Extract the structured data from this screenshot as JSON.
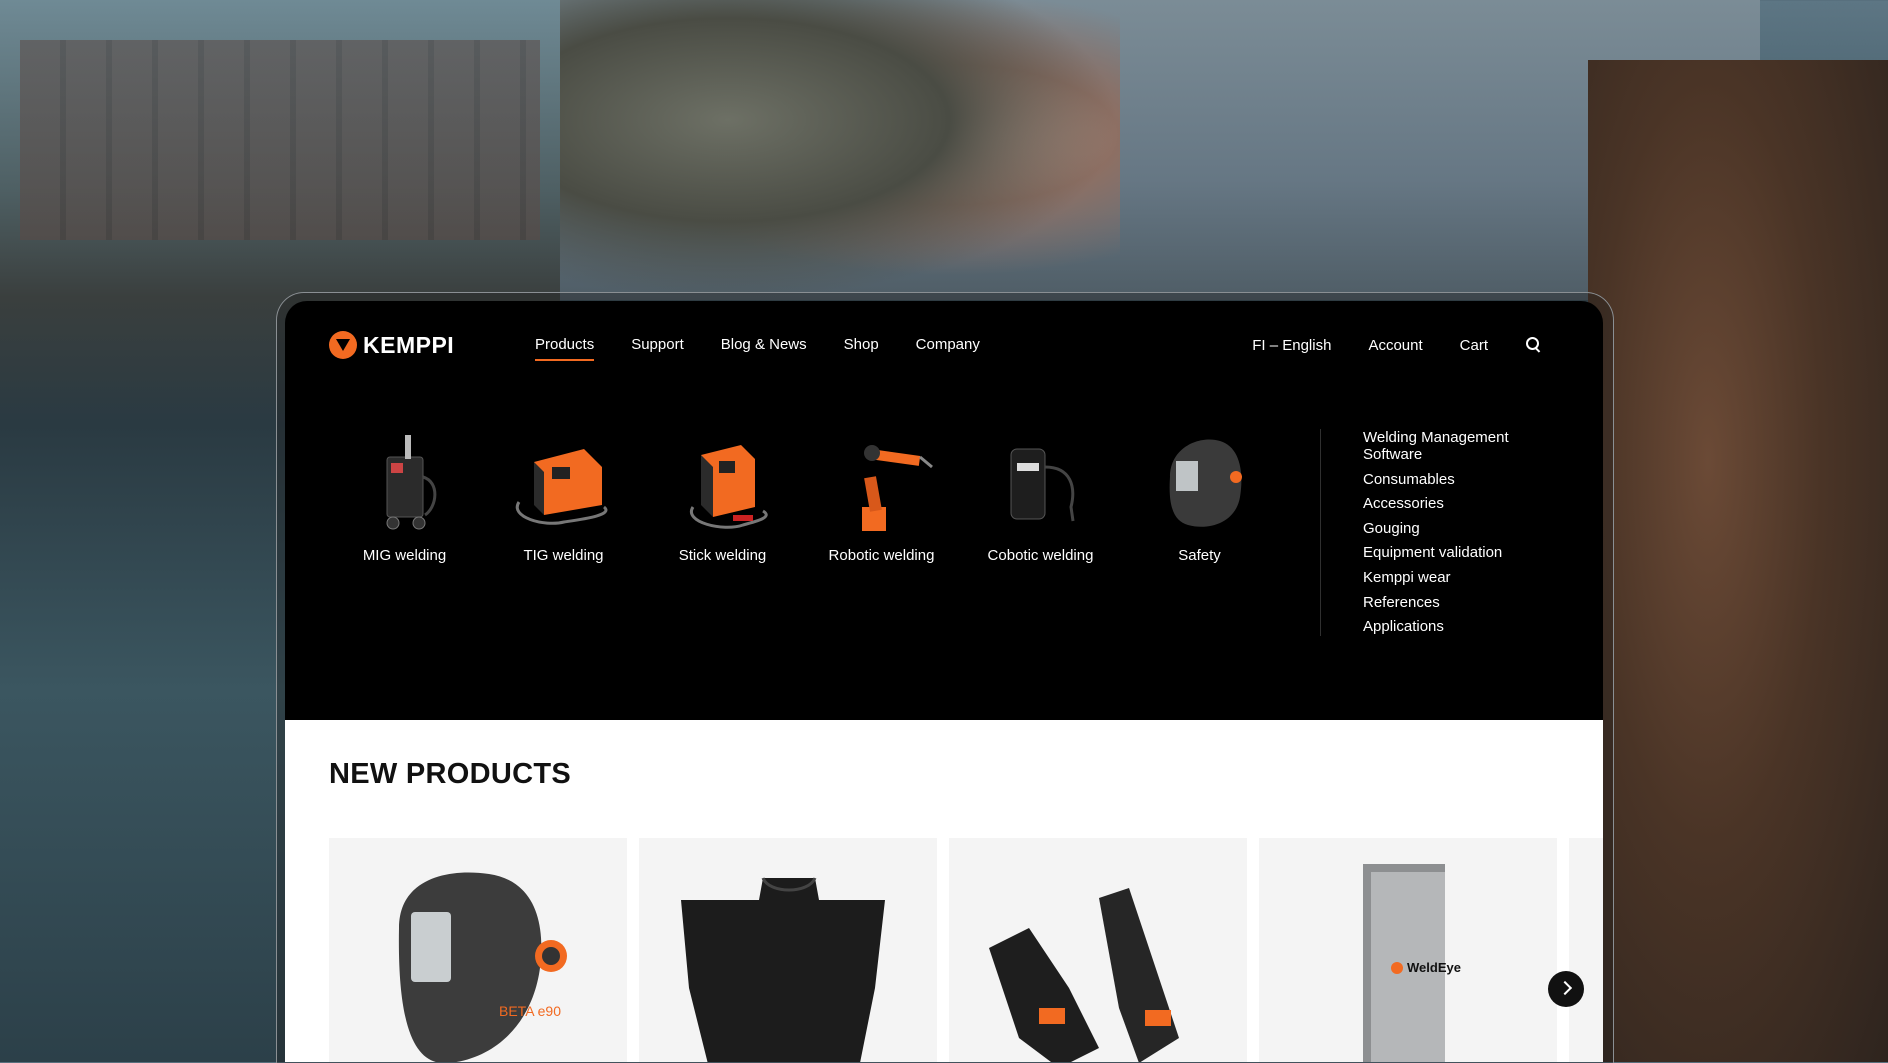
{
  "brand": {
    "name": "KEMPPI",
    "accent": "#f26a21"
  },
  "nav": {
    "items": [
      {
        "label": "Products",
        "active": true
      },
      {
        "label": "Support"
      },
      {
        "label": "Blog & News"
      },
      {
        "label": "Shop"
      },
      {
        "label": "Company"
      }
    ]
  },
  "util": {
    "language": "FI – English",
    "account": "Account",
    "cart": "Cart",
    "search_icon": "search-icon"
  },
  "categories": [
    {
      "label": "MIG welding",
      "icon": "mig-welder-image"
    },
    {
      "label": "TIG welding",
      "icon": "tig-welder-image"
    },
    {
      "label": "Stick welding",
      "icon": "stick-welder-image"
    },
    {
      "label": "Robotic welding",
      "icon": "robot-arm-image"
    },
    {
      "label": "Cobotic welding",
      "icon": "cobot-image"
    },
    {
      "label": "Safety",
      "icon": "helmet-image"
    }
  ],
  "links": [
    "Welding Management Software",
    "Consumables",
    "Accessories",
    "Gouging",
    "Equipment validation",
    "Kemppi wear",
    "References",
    "Applications"
  ],
  "new_products": {
    "title": "NEW PRODUCTS",
    "cards": [
      {
        "image": "welding-helmet-image",
        "text": "BETA e90"
      },
      {
        "image": "welding-apron-image"
      },
      {
        "image": "welding-gloves-image"
      },
      {
        "image": "weldeye-box-image",
        "text": "WeldEye"
      }
    ],
    "next_icon": "chevron-right-icon"
  }
}
